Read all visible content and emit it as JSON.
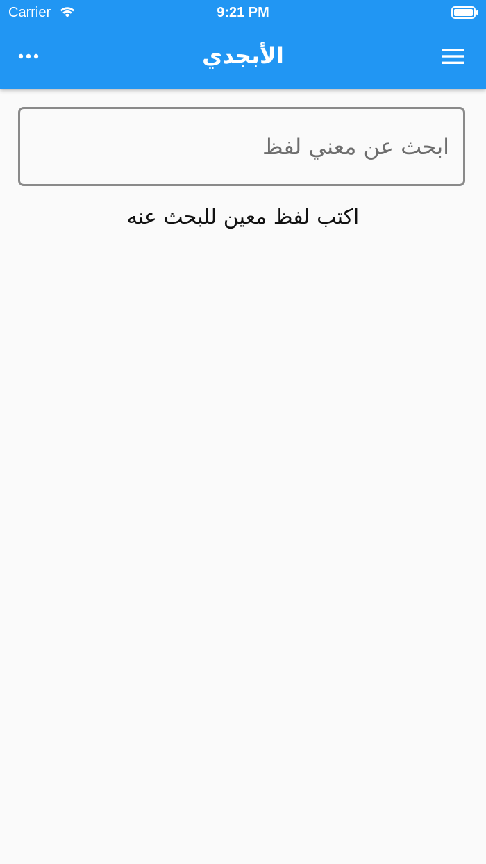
{
  "status_bar": {
    "carrier": "Carrier",
    "time": "9:21 PM",
    "wifi_icon": "wifi-icon",
    "battery_icon": "battery-icon"
  },
  "appbar": {
    "title": "الأبجدي",
    "background_color": "#2196f3",
    "left_icon": "more-horizontal-icon",
    "right_icon": "hamburger-menu-icon"
  },
  "search": {
    "placeholder": "ابحث عن معني لفظ",
    "value": ""
  },
  "hint_text": "اكتب لفظ معين للبحث عنه"
}
